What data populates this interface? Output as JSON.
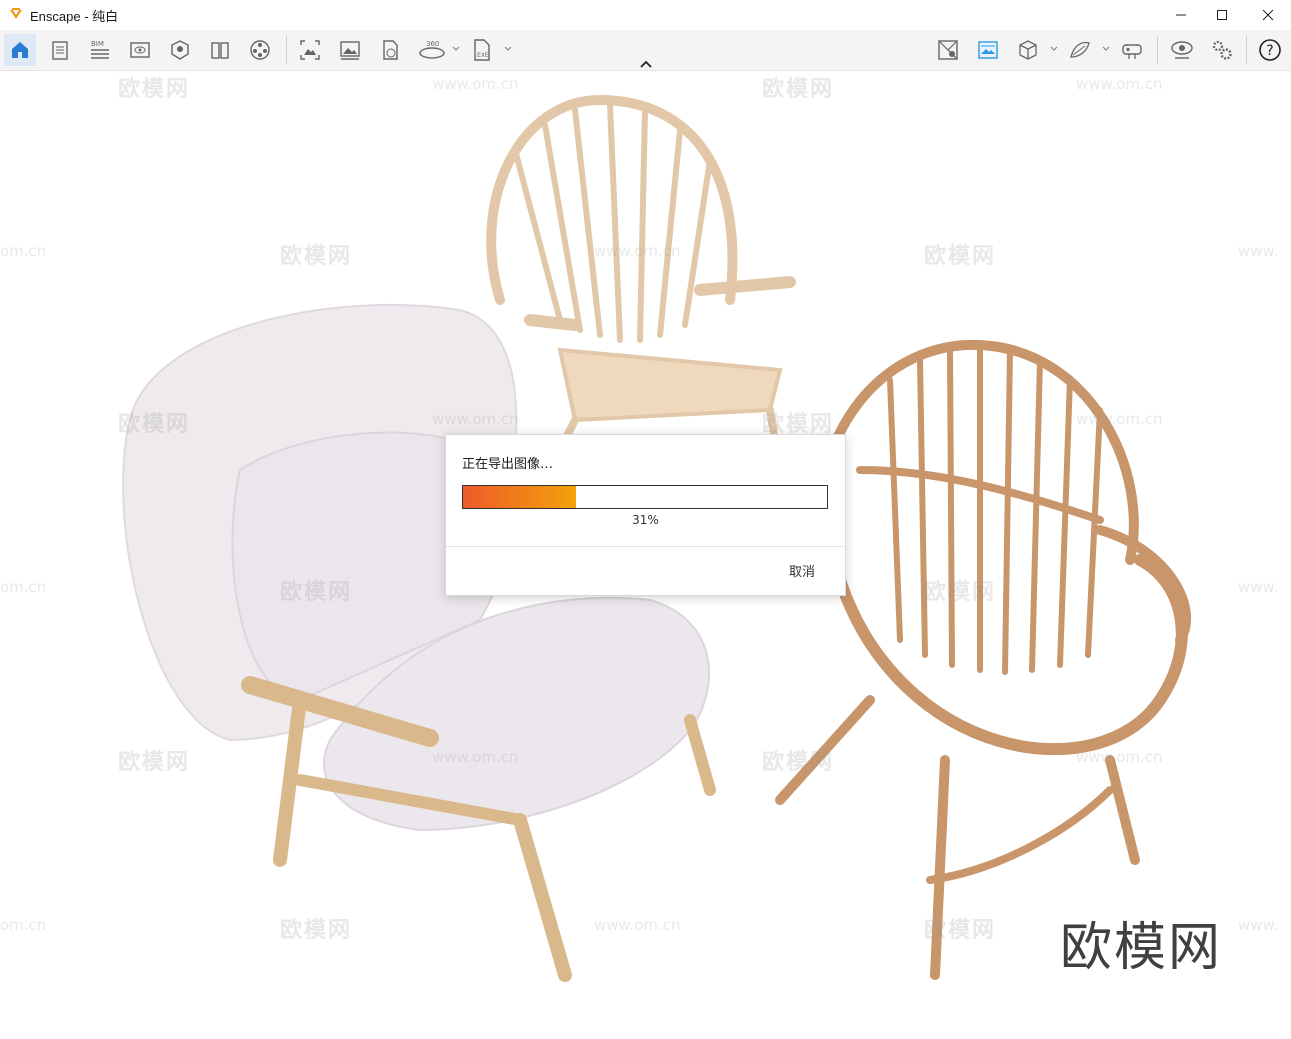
{
  "window": {
    "title": "Enscape - 纯白",
    "controls": [
      "minimize-icon",
      "maximize-icon",
      "close-icon"
    ]
  },
  "toolbar": {
    "left_icons": [
      "home-icon",
      "document-settings-icon",
      "bim-icon",
      "view-management-icon",
      "asset-library-icon",
      "material-editor-icon",
      "video-editor-icon",
      "screenshot-icon",
      "batch-render-icon",
      "export-web-icon",
      "export-panorama-icon",
      "export-exe-icon"
    ],
    "bim_label": "BIM",
    "panorama_label": "360",
    "exe_label": "EXE",
    "right_icons": [
      "sync-views-icon",
      "image-settings-icon",
      "cube-view-icon",
      "render-mode-icon",
      "vr-headset-icon",
      "visual-settings-icon",
      "general-settings-icon",
      "help-icon"
    ]
  },
  "dialog": {
    "title": "正在导出图像…",
    "progress": 0.31,
    "progress_text": "31%",
    "cancel_label": "取消"
  },
  "watermarks": {
    "logo_text": "欧模网",
    "url_text": "www.om.cn",
    "edge_text": "om.cn",
    "edge_right": "www."
  },
  "colors": {
    "accent_blue": "#2b7cd3",
    "progress_start": "#ee5a2a",
    "progress_end": "#f2a20a",
    "logo_orange": "#f39c12"
  }
}
